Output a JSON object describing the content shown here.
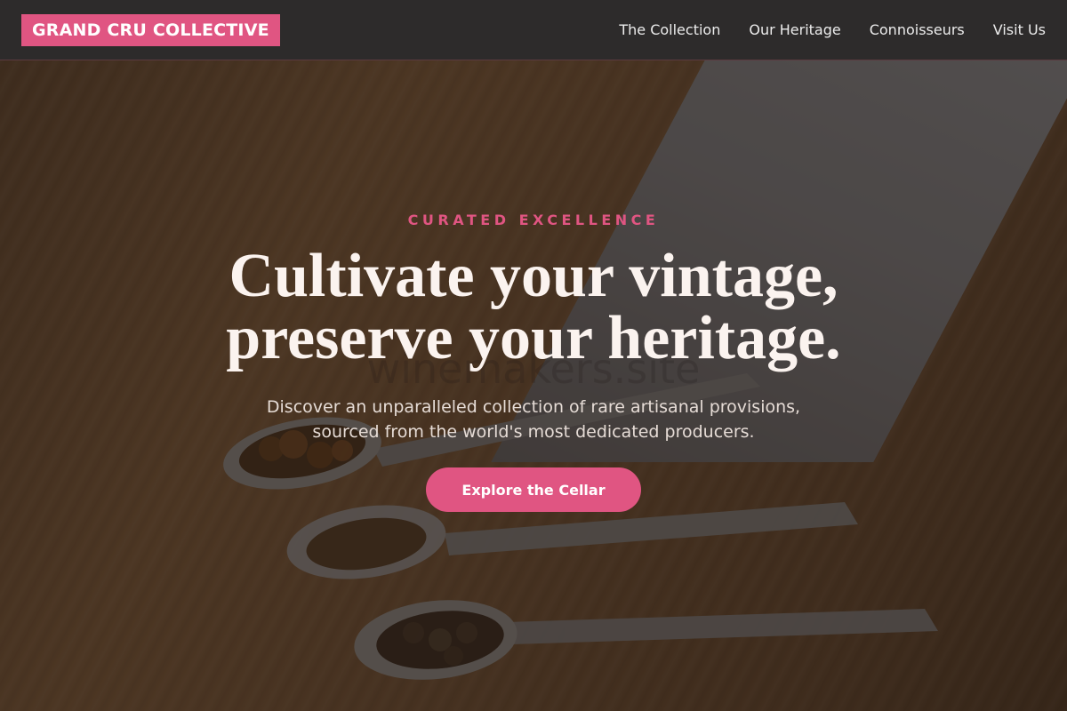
{
  "brand": {
    "name": "GRAND CRU COLLECTIVE",
    "accent_color": "#e05582"
  },
  "nav": {
    "items": [
      {
        "label": "The Collection"
      },
      {
        "label": "Our Heritage"
      },
      {
        "label": "Connoisseurs"
      },
      {
        "label": "Visit Us"
      }
    ]
  },
  "hero": {
    "eyebrow": "CURATED EXCELLENCE",
    "headline_line1": "Cultivate your vintage,",
    "headline_line2": "preserve your heritage.",
    "subtext_line1": "Discover an unparalleled collection of rare artisanal provisions,",
    "subtext_line2": "sourced from the world's most dedicated producers.",
    "cta_label": "Explore the Cellar",
    "watermark": "winemakers.site"
  }
}
